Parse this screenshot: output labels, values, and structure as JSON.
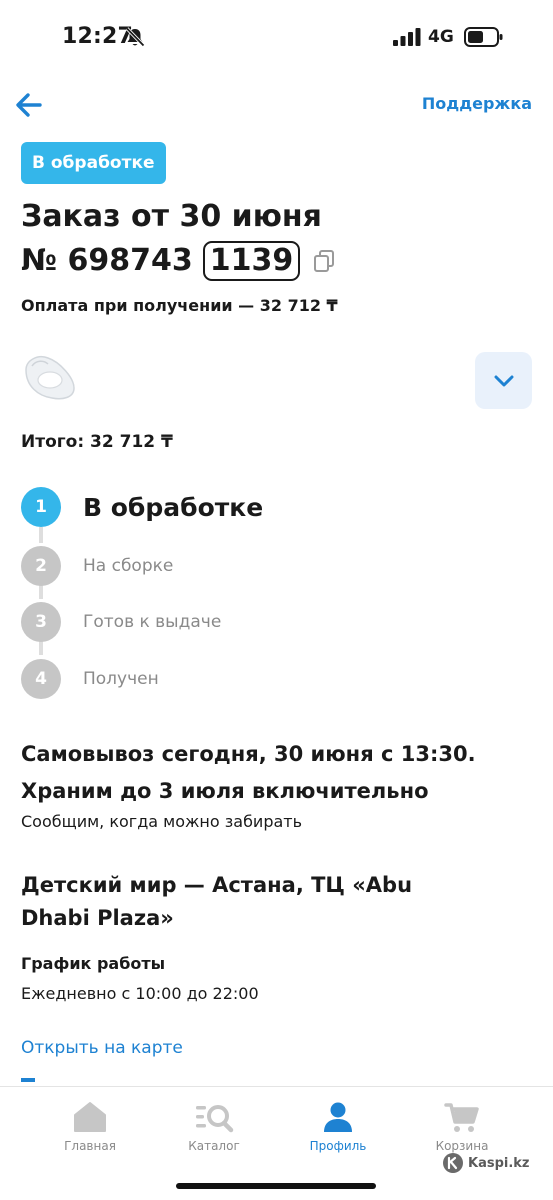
{
  "status_bar": {
    "time": "12:27",
    "network": "4G"
  },
  "header": {
    "support_label": "Поддержка"
  },
  "order": {
    "status_badge": "В обработке",
    "title": "Заказ от 30 июня",
    "number_prefix": "№ 698743",
    "number_code": "1139",
    "payment": "Оплата при получении — 32 712 ₸",
    "total": "Итого: 32 712 ₸"
  },
  "steps": [
    {
      "num": "1",
      "label": "В обработке",
      "active": true
    },
    {
      "num": "2",
      "label": "На сборке",
      "active": false
    },
    {
      "num": "3",
      "label": "Готов к выдаче",
      "active": false
    },
    {
      "num": "4",
      "label": "Получен",
      "active": false
    }
  ],
  "pickup": {
    "line1": "Самовывоз сегодня, 30 июня с 13:30.",
    "line2": "Храним до 3 июля включительно",
    "notice": "Сообщим, когда можно забирать"
  },
  "store": {
    "name": "Детский мир — Астана, ТЦ «Abu Dhabi Plaza»",
    "schedule_title": "График работы",
    "schedule_value": "Ежедневно с 10:00 до 22:00",
    "map_link": "Открыть на карте"
  },
  "tabs": [
    {
      "label": "Главная",
      "icon": "home-icon",
      "active": false
    },
    {
      "label": "Каталог",
      "icon": "catalog-search-icon",
      "active": false
    },
    {
      "label": "Профиль",
      "icon": "profile-icon",
      "active": true
    },
    {
      "label": "Корзина",
      "icon": "cart-icon",
      "active": false
    }
  ],
  "watermark": "Kaspi.kz",
  "colors": {
    "accent": "#34b6ea",
    "link": "#1e82d2",
    "inactive": "#c6c6c6"
  }
}
